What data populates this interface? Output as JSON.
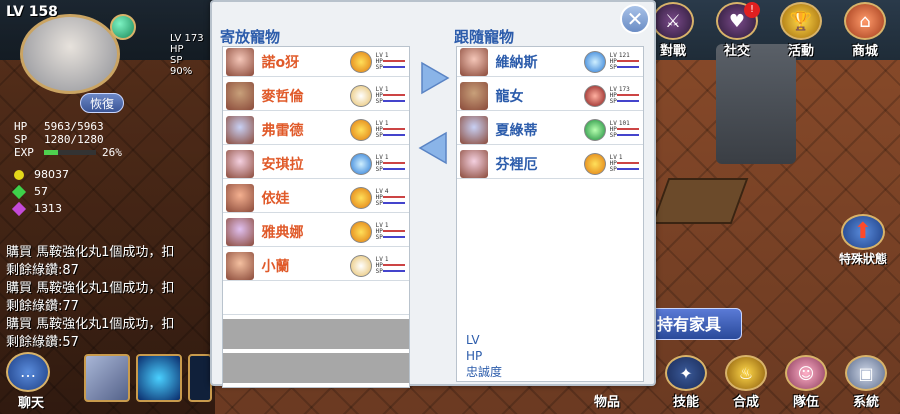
{
  "player": {
    "lv_label": "LV",
    "level": "158",
    "recover_label": "恢復",
    "hp_label": "HP",
    "hp_value": "5963/5963",
    "sp_label": "SP",
    "sp_value": "1280/1280",
    "exp_label": "EXP",
    "exp_percent": "26%",
    "exp_fraction": 0.26,
    "gold": "98037",
    "green_gems": "57",
    "purple_gems": "1313"
  },
  "mini_unit": {
    "lv": "LV 173",
    "hp": "HP",
    "sp": "SP",
    "percent": "90%"
  },
  "chat_lines": [
    "購買 馬鞍強化丸1個成功，扣",
    "剩餘綠鑽:87",
    "購買 馬鞍強化丸1個成功，扣",
    "剩餘綠鑽:77",
    "購買 馬鞍強化丸1個成功，扣",
    "剩餘綠鑽:57"
  ],
  "chat_button": "聊天",
  "top_menu": [
    {
      "label": "對戰",
      "icon": "sword-icon"
    },
    {
      "label": "社交",
      "icon": "social-icon",
      "badge": "!"
    },
    {
      "label": "活動",
      "icon": "trophy-icon"
    },
    {
      "label": "商城",
      "icon": "shop-icon"
    }
  ],
  "special_status": "特殊狀態",
  "own_furniture": "持有家具",
  "items_partial": "物品",
  "bottom_menu": [
    {
      "label": "技能",
      "icon": "skill-icon"
    },
    {
      "label": "合成",
      "icon": "synthesis-icon"
    },
    {
      "label": "隊伍",
      "icon": "party-icon"
    },
    {
      "label": "系統",
      "icon": "system-icon"
    }
  ],
  "dialog": {
    "left_title": "寄放寵物",
    "right_title": "跟隨寵物",
    "close_symbol": "✕",
    "stored_pets": [
      {
        "name": "諾o犽",
        "element": "fire",
        "lv": "1"
      },
      {
        "name": "麥哲倫",
        "element": "wind",
        "lv": "1"
      },
      {
        "name": "弗雷德",
        "element": "fire",
        "lv": "1"
      },
      {
        "name": "安琪拉",
        "element": "ice",
        "lv": "1"
      },
      {
        "name": "依娃",
        "element": "fire",
        "lv": "4"
      },
      {
        "name": "雅典娜",
        "element": "fire",
        "lv": "1"
      },
      {
        "name": "小蘭",
        "element": "wind",
        "lv": "1"
      }
    ],
    "following_pets": [
      {
        "name": "維納斯",
        "element": "ice",
        "lv": "121"
      },
      {
        "name": "龍女",
        "element": "dark",
        "lv": "173"
      },
      {
        "name": "夏綠蒂",
        "element": "earth",
        "lv": "101"
      },
      {
        "name": "芬裡厄",
        "element": "fire",
        "lv": "1"
      }
    ],
    "info_lv": "LV",
    "info_hp": "HP",
    "info_loyalty": "忠誠度",
    "stat_labels": {
      "lv": "LV",
      "hp": "HP",
      "sp": "SP"
    }
  },
  "colors": {
    "dialog_bg": "#eef1f4",
    "title_blue": "#2c5cab",
    "name_orange": "#e05a2a",
    "arrow_blue": "#8ab4e8"
  }
}
